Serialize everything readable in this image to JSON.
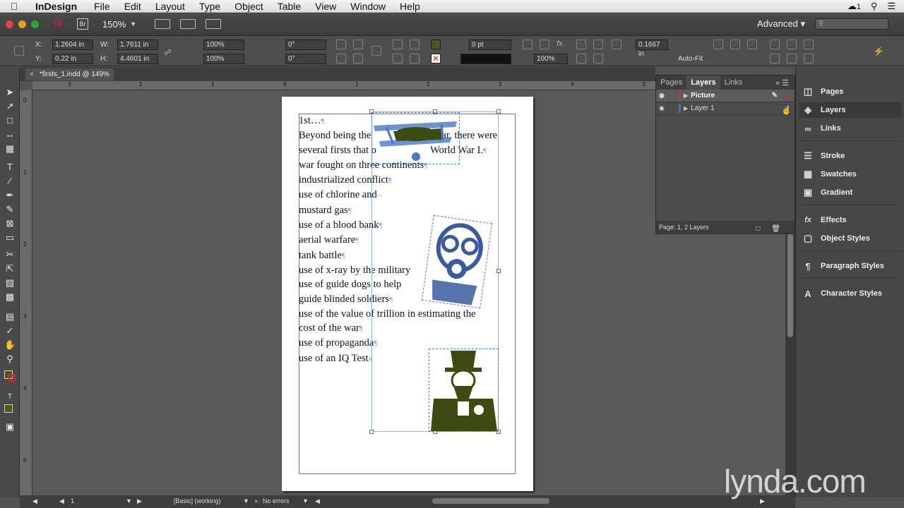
{
  "menubar": {
    "app": "InDesign",
    "menus": [
      "File",
      "Edit",
      "Layout",
      "Type",
      "Object",
      "Table",
      "View",
      "Window",
      "Help"
    ],
    "cc_badge": "1"
  },
  "appbar": {
    "zoom": "150%",
    "workspace": "Advanced"
  },
  "control": {
    "x": "1.2604 in",
    "y": "0.22 in",
    "w": "1.7611 in",
    "h": "4.4601 in",
    "scale_x": "100%",
    "scale_y": "100%",
    "rotate": "0°",
    "shear": "0°",
    "stroke_weight": "0 pt",
    "opacity": "100%",
    "spacing": "0.1667 in",
    "autofit": "Auto-Fit"
  },
  "tab": {
    "title": "*firsts_1.indd @ 149%"
  },
  "rulers": {
    "h": [
      "3",
      "2",
      "1",
      "0",
      "1",
      "2",
      "3",
      "4",
      "5"
    ],
    "v": [
      "0",
      "1",
      "2",
      "3",
      "4",
      "5"
    ]
  },
  "document": {
    "lines": [
      "1st…",
      "Beyond being the ",
      "several firsts that o",
      "war fought on three continents",
      "industrialized conflict",
      "use of chlorine and",
      "mustard gas",
      "use of a blood bank",
      "aerial warfare",
      "tank battle",
      "use of x-ray by the military",
      "use of guide dogs to help",
      "guide blinded soldiers",
      "use of the value of trillion in estimating the",
      "cost of the war",
      "use of propaganda",
      "use of an IQ Test"
    ],
    "line2_tail": "war, there were",
    "line3_tail": "World War I."
  },
  "layers_panel": {
    "tabs": [
      "Pages",
      "Layers",
      "Links"
    ],
    "layers": [
      {
        "name": "Picture",
        "color": "#d0342c"
      },
      {
        "name": "Layer 1",
        "color": "#3f6fd1"
      }
    ],
    "footer": "Page: 1, 2 Layers"
  },
  "dock": {
    "items": [
      "Pages",
      "Layers",
      "Links",
      "Stroke",
      "Swatches",
      "Gradient",
      "Effects",
      "Object Styles",
      "Paragraph Styles",
      "Character Styles"
    ]
  },
  "status": {
    "page": "1",
    "profile": "[Basic] (working)",
    "errors": "No errors"
  },
  "watermark": "lynda.com"
}
